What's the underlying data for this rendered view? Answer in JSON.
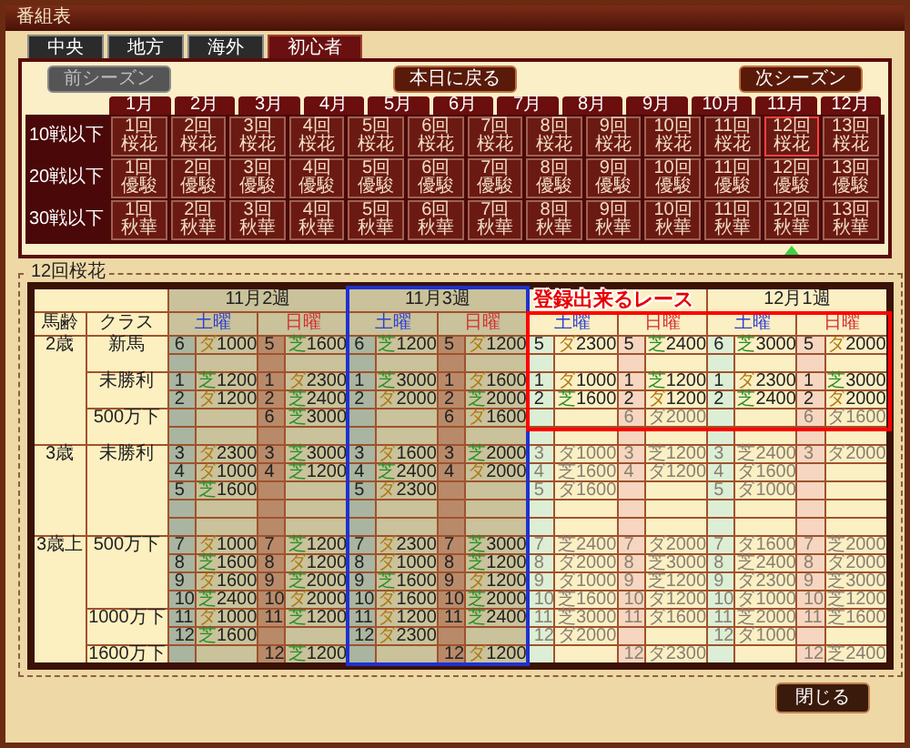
{
  "window": {
    "title": "番組表"
  },
  "tabs": [
    {
      "label": "中央",
      "selected": false
    },
    {
      "label": "地方",
      "selected": false
    },
    {
      "label": "海外",
      "selected": false
    },
    {
      "label": "初心者",
      "selected": true
    }
  ],
  "season_buttons": [
    {
      "label": "前シーズン",
      "disabled": true
    },
    {
      "label": "本日に戻る",
      "disabled": false
    },
    {
      "label": "次シーズン",
      "disabled": false
    }
  ],
  "race_calendar": {
    "months": [
      "1月",
      "2月",
      "3月",
      "4月",
      "5月",
      "6月",
      "7月",
      "8月",
      "9月",
      "10月",
      "11月",
      "12月"
    ],
    "rows": [
      {
        "label": "10戦以下",
        "cells": [
          {
            "label": "1回桜花",
            "selected": false,
            "today": false
          },
          {
            "label": "2回桜花",
            "selected": false,
            "today": false
          },
          {
            "label": "3回桜花",
            "selected": false,
            "today": false
          },
          {
            "label": "4回桜花",
            "selected": false,
            "today": false
          },
          {
            "label": "5回桜花",
            "selected": false,
            "today": false
          },
          {
            "label": "6回桜花",
            "selected": false,
            "today": false
          },
          {
            "label": "7回桜花",
            "selected": false,
            "today": false
          },
          {
            "label": "8回桜花",
            "selected": false,
            "today": false
          },
          {
            "label": "9回桜花",
            "selected": false,
            "today": false
          },
          {
            "label": "10回桜花",
            "selected": false,
            "today": false
          },
          {
            "label": "11回桜花",
            "selected": false,
            "today": false
          },
          {
            "label": "12回桜花",
            "selected": true,
            "today": false
          },
          {
            "label": "13回桜花",
            "selected": false,
            "today": false
          }
        ]
      },
      {
        "label": "20戦以下",
        "cells": [
          {
            "label": "1回優駿",
            "selected": false,
            "today": false
          },
          {
            "label": "2回優駿",
            "selected": false,
            "today": false
          },
          {
            "label": "3回優駿",
            "selected": false,
            "today": false
          },
          {
            "label": "4回優駿",
            "selected": false,
            "today": false
          },
          {
            "label": "5回優駿",
            "selected": false,
            "today": false
          },
          {
            "label": "6回優駿",
            "selected": false,
            "today": false
          },
          {
            "label": "7回優駿",
            "selected": false,
            "today": false
          },
          {
            "label": "8回優駿",
            "selected": false,
            "today": false
          },
          {
            "label": "9回優駿",
            "selected": false,
            "today": false
          },
          {
            "label": "10回優駿",
            "selected": false,
            "today": false
          },
          {
            "label": "11回優駿",
            "selected": false,
            "today": false
          },
          {
            "label": "12回優駿",
            "selected": false,
            "today": false
          },
          {
            "label": "13回優駿",
            "selected": false,
            "today": false
          }
        ]
      },
      {
        "label": "30戦以下",
        "cells": [
          {
            "label": "1回秋華",
            "selected": false,
            "today": false
          },
          {
            "label": "2回秋華",
            "selected": false,
            "today": false
          },
          {
            "label": "3回秋華",
            "selected": false,
            "today": false
          },
          {
            "label": "4回秋華",
            "selected": false,
            "today": false
          },
          {
            "label": "5回秋華",
            "selected": false,
            "today": false
          },
          {
            "label": "6回秋華",
            "selected": false,
            "today": false
          },
          {
            "label": "7回秋華",
            "selected": false,
            "today": false
          },
          {
            "label": "8回秋華",
            "selected": false,
            "today": false
          },
          {
            "label": "9回秋華",
            "selected": false,
            "today": false
          },
          {
            "label": "10回秋華",
            "selected": false,
            "today": false
          },
          {
            "label": "11回秋華",
            "selected": false,
            "today": false
          },
          {
            "label": "12回秋華",
            "selected": false,
            "today": true
          },
          {
            "label": "13回秋華",
            "selected": false,
            "today": false
          }
        ]
      }
    ]
  },
  "schedule": {
    "title": "12回桜花",
    "age_heading": "馬齢",
    "class_heading": "クラス",
    "weeks": [
      {
        "label": "11月2週",
        "past": true,
        "current": false,
        "days": [
          {
            "label": "土曜",
            "kind": "sat"
          },
          {
            "label": "日曜",
            "kind": "sun"
          }
        ]
      },
      {
        "label": "11月3週",
        "past": true,
        "current": true,
        "days": [
          {
            "label": "土曜",
            "kind": "sat"
          },
          {
            "label": "日曜",
            "kind": "sun"
          }
        ]
      },
      {
        "past": false,
        "current": false,
        "days": [
          {
            "label": "土曜",
            "kind": "sat"
          },
          {
            "label": "日曜",
            "kind": "sun"
          }
        ]
      },
      {
        "label": "12月1週",
        "past": false,
        "current": false,
        "days": [
          {
            "label": "土曜",
            "kind": "sat"
          },
          {
            "label": "日曜",
            "kind": "sun"
          }
        ]
      }
    ],
    "groups": [
      {
        "age": "2歳",
        "classes": [
          {
            "name": "新馬",
            "lines": [
              {
                "kind": "races",
                "cells": [
                  {
                    "no": "6",
                    "surface": "ダ",
                    "distance": "1000",
                    "kind": "dirt",
                    "open": true
                  },
                  {
                    "no": "5",
                    "surface": "芝",
                    "distance": "1600",
                    "kind": "turf",
                    "open": true
                  },
                  {
                    "no": "6",
                    "surface": "芝",
                    "distance": "1200",
                    "kind": "turf",
                    "open": true
                  },
                  {
                    "no": "5",
                    "surface": "ダ",
                    "distance": "1200",
                    "kind": "dirt",
                    "open": true
                  },
                  {
                    "no": "5",
                    "surface": "ダ",
                    "distance": "2300",
                    "kind": "dirt",
                    "open": true
                  },
                  {
                    "no": "5",
                    "surface": "芝",
                    "distance": "2400",
                    "kind": "turf",
                    "open": true
                  },
                  {
                    "no": "6",
                    "surface": "芝",
                    "distance": "3000",
                    "kind": "turf",
                    "open": true
                  },
                  {
                    "no": "5",
                    "surface": "ダ",
                    "distance": "2000",
                    "kind": "dirt",
                    "open": true
                  }
                ]
              },
              {
                "kind": "blank"
              }
            ]
          },
          {
            "name": "未勝利",
            "lines": [
              {
                "kind": "races",
                "cells": [
                  {
                    "no": "1",
                    "surface": "芝",
                    "distance": "1200",
                    "kind": "turf",
                    "open": true
                  },
                  {
                    "no": "1",
                    "surface": "ダ",
                    "distance": "2300",
                    "kind": "dirt",
                    "open": true
                  },
                  {
                    "no": "1",
                    "surface": "芝",
                    "distance": "3000",
                    "kind": "turf",
                    "open": true
                  },
                  {
                    "no": "1",
                    "surface": "ダ",
                    "distance": "1600",
                    "kind": "dirt",
                    "open": true
                  },
                  {
                    "no": "1",
                    "surface": "ダ",
                    "distance": "1000",
                    "kind": "dirt",
                    "open": true
                  },
                  {
                    "no": "1",
                    "surface": "芝",
                    "distance": "1200",
                    "kind": "turf",
                    "open": true
                  },
                  {
                    "no": "1",
                    "surface": "ダ",
                    "distance": "2300",
                    "kind": "dirt",
                    "open": true
                  },
                  {
                    "no": "1",
                    "surface": "芝",
                    "distance": "3000",
                    "kind": "turf",
                    "open": true
                  }
                ]
              },
              {
                "kind": "races",
                "cells": [
                  {
                    "no": "2",
                    "surface": "ダ",
                    "distance": "1200",
                    "kind": "dirt",
                    "open": true
                  },
                  {
                    "no": "2",
                    "surface": "芝",
                    "distance": "2400",
                    "kind": "turf",
                    "open": true
                  },
                  {
                    "no": "2",
                    "surface": "ダ",
                    "distance": "2000",
                    "kind": "dirt",
                    "open": true
                  },
                  {
                    "no": "2",
                    "surface": "芝",
                    "distance": "2000",
                    "kind": "turf",
                    "open": true
                  },
                  {
                    "no": "2",
                    "surface": "芝",
                    "distance": "1600",
                    "kind": "turf",
                    "open": true
                  },
                  {
                    "no": "2",
                    "surface": "ダ",
                    "distance": "1200",
                    "kind": "dirt",
                    "open": true
                  },
                  {
                    "no": "2",
                    "surface": "芝",
                    "distance": "2400",
                    "kind": "turf",
                    "open": true
                  },
                  {
                    "no": "2",
                    "surface": "ダ",
                    "distance": "2000",
                    "kind": "dirt",
                    "open": true
                  }
                ]
              }
            ]
          },
          {
            "name": "500万下",
            "lines": [
              {
                "kind": "races",
                "cells": [
                  {
                    "kind": "none"
                  },
                  {
                    "no": "6",
                    "surface": "芝",
                    "distance": "3000",
                    "kind": "turf",
                    "open": true
                  },
                  {
                    "kind": "none"
                  },
                  {
                    "no": "6",
                    "surface": "ダ",
                    "distance": "1600",
                    "kind": "dirt",
                    "open": true
                  },
                  {
                    "kind": "none"
                  },
                  {
                    "no": "6",
                    "surface": "ダ",
                    "distance": "2000",
                    "kind": "dirt",
                    "open": false
                  },
                  {
                    "kind": "none"
                  },
                  {
                    "no": "6",
                    "surface": "ダ",
                    "distance": "1600",
                    "kind": "dirt",
                    "open": false
                  }
                ]
              },
              {
                "kind": "blank"
              }
            ]
          }
        ]
      },
      {
        "age": "3歳",
        "classes": [
          {
            "name": "未勝利",
            "lines": [
              {
                "kind": "races",
                "cells": [
                  {
                    "no": "3",
                    "surface": "ダ",
                    "distance": "2300",
                    "kind": "dirt",
                    "open": true
                  },
                  {
                    "no": "3",
                    "surface": "芝",
                    "distance": "3000",
                    "kind": "turf",
                    "open": true
                  },
                  {
                    "no": "3",
                    "surface": "ダ",
                    "distance": "1600",
                    "kind": "dirt",
                    "open": true
                  },
                  {
                    "no": "3",
                    "surface": "芝",
                    "distance": "2000",
                    "kind": "turf",
                    "open": true
                  },
                  {
                    "no": "3",
                    "surface": "ダ",
                    "distance": "1000",
                    "kind": "dirt",
                    "open": false
                  },
                  {
                    "no": "3",
                    "surface": "芝",
                    "distance": "1200",
                    "kind": "turf",
                    "open": false
                  },
                  {
                    "no": "3",
                    "surface": "芝",
                    "distance": "2400",
                    "kind": "turf",
                    "open": false
                  },
                  {
                    "no": "3",
                    "surface": "ダ",
                    "distance": "2000",
                    "kind": "dirt",
                    "open": false
                  }
                ]
              },
              {
                "kind": "races",
                "cells": [
                  {
                    "no": "4",
                    "surface": "ダ",
                    "distance": "1000",
                    "kind": "dirt",
                    "open": true
                  },
                  {
                    "no": "4",
                    "surface": "芝",
                    "distance": "1200",
                    "kind": "turf",
                    "open": true
                  },
                  {
                    "no": "4",
                    "surface": "芝",
                    "distance": "2400",
                    "kind": "turf",
                    "open": true
                  },
                  {
                    "no": "4",
                    "surface": "ダ",
                    "distance": "2000",
                    "kind": "dirt",
                    "open": true
                  },
                  {
                    "no": "4",
                    "surface": "芝",
                    "distance": "1600",
                    "kind": "turf",
                    "open": false
                  },
                  {
                    "no": "4",
                    "surface": "ダ",
                    "distance": "1200",
                    "kind": "dirt",
                    "open": false
                  },
                  {
                    "no": "4",
                    "surface": "ダ",
                    "distance": "1600",
                    "kind": "dirt",
                    "open": false
                  },
                  {
                    "kind": "none"
                  }
                ]
              },
              {
                "kind": "races",
                "cells": [
                  {
                    "no": "5",
                    "surface": "芝",
                    "distance": "1600",
                    "kind": "turf",
                    "open": true
                  },
                  {
                    "kind": "none"
                  },
                  {
                    "no": "5",
                    "surface": "ダ",
                    "distance": "2300",
                    "kind": "dirt",
                    "open": true
                  },
                  {
                    "kind": "none"
                  },
                  {
                    "no": "5",
                    "surface": "ダ",
                    "distance": "1600",
                    "kind": "dirt",
                    "open": false
                  },
                  {
                    "kind": "none"
                  },
                  {
                    "no": "5",
                    "surface": "ダ",
                    "distance": "1000",
                    "kind": "dirt",
                    "open": false
                  },
                  {
                    "kind": "none"
                  }
                ]
              },
              {
                "kind": "blank"
              },
              {
                "kind": "blank"
              }
            ]
          }
        ]
      },
      {
        "age": "3歳上",
        "classes": [
          {
            "name": "500万下",
            "lines": [
              {
                "kind": "races",
                "cells": [
                  {
                    "no": "7",
                    "surface": "ダ",
                    "distance": "1000",
                    "kind": "dirt",
                    "open": true
                  },
                  {
                    "no": "7",
                    "surface": "芝",
                    "distance": "1200",
                    "kind": "turf",
                    "open": true
                  },
                  {
                    "no": "7",
                    "surface": "ダ",
                    "distance": "2300",
                    "kind": "dirt",
                    "open": true
                  },
                  {
                    "no": "7",
                    "surface": "芝",
                    "distance": "3000",
                    "kind": "turf",
                    "open": true
                  },
                  {
                    "no": "7",
                    "surface": "芝",
                    "distance": "2400",
                    "kind": "turf",
                    "open": false
                  },
                  {
                    "no": "7",
                    "surface": "ダ",
                    "distance": "2000",
                    "kind": "dirt",
                    "open": false
                  },
                  {
                    "no": "7",
                    "surface": "ダ",
                    "distance": "1600",
                    "kind": "dirt",
                    "open": false
                  },
                  {
                    "no": "7",
                    "surface": "芝",
                    "distance": "2000",
                    "kind": "turf",
                    "open": false
                  }
                ]
              },
              {
                "kind": "races",
                "cells": [
                  {
                    "no": "8",
                    "surface": "芝",
                    "distance": "1600",
                    "kind": "turf",
                    "open": true
                  },
                  {
                    "no": "8",
                    "surface": "ダ",
                    "distance": "1200",
                    "kind": "dirt",
                    "open": true
                  },
                  {
                    "no": "8",
                    "surface": "ダ",
                    "distance": "1000",
                    "kind": "dirt",
                    "open": true
                  },
                  {
                    "no": "8",
                    "surface": "芝",
                    "distance": "1200",
                    "kind": "turf",
                    "open": true
                  },
                  {
                    "no": "8",
                    "surface": "ダ",
                    "distance": "2000",
                    "kind": "dirt",
                    "open": false
                  },
                  {
                    "no": "8",
                    "surface": "芝",
                    "distance": "3000",
                    "kind": "turf",
                    "open": false
                  },
                  {
                    "no": "8",
                    "surface": "芝",
                    "distance": "2400",
                    "kind": "turf",
                    "open": false
                  },
                  {
                    "no": "8",
                    "surface": "ダ",
                    "distance": "2000",
                    "kind": "dirt",
                    "open": false
                  }
                ]
              },
              {
                "kind": "races",
                "cells": [
                  {
                    "no": "9",
                    "surface": "ダ",
                    "distance": "1600",
                    "kind": "dirt",
                    "open": true
                  },
                  {
                    "no": "9",
                    "surface": "芝",
                    "distance": "2000",
                    "kind": "turf",
                    "open": true
                  },
                  {
                    "no": "9",
                    "surface": "芝",
                    "distance": "1600",
                    "kind": "turf",
                    "open": true
                  },
                  {
                    "no": "9",
                    "surface": "ダ",
                    "distance": "1200",
                    "kind": "dirt",
                    "open": true
                  },
                  {
                    "no": "9",
                    "surface": "ダ",
                    "distance": "1000",
                    "kind": "dirt",
                    "open": false
                  },
                  {
                    "no": "9",
                    "surface": "芝",
                    "distance": "1200",
                    "kind": "turf",
                    "open": false
                  },
                  {
                    "no": "9",
                    "surface": "ダ",
                    "distance": "2300",
                    "kind": "dirt",
                    "open": false
                  },
                  {
                    "no": "9",
                    "surface": "芝",
                    "distance": "3000",
                    "kind": "turf",
                    "open": false
                  }
                ]
              },
              {
                "kind": "races",
                "cells": [
                  {
                    "no": "10",
                    "surface": "芝",
                    "distance": "2400",
                    "kind": "turf",
                    "open": true
                  },
                  {
                    "no": "10",
                    "surface": "ダ",
                    "distance": "2000",
                    "kind": "dirt",
                    "open": true
                  },
                  {
                    "no": "10",
                    "surface": "ダ",
                    "distance": "1600",
                    "kind": "dirt",
                    "open": true
                  },
                  {
                    "no": "10",
                    "surface": "芝",
                    "distance": "2000",
                    "kind": "turf",
                    "open": true
                  },
                  {
                    "no": "10",
                    "surface": "芝",
                    "distance": "1600",
                    "kind": "turf",
                    "open": false
                  },
                  {
                    "no": "10",
                    "surface": "ダ",
                    "distance": "1200",
                    "kind": "dirt",
                    "open": false
                  },
                  {
                    "no": "10",
                    "surface": "ダ",
                    "distance": "1000",
                    "kind": "dirt",
                    "open": false
                  },
                  {
                    "no": "10",
                    "surface": "芝",
                    "distance": "1200",
                    "kind": "turf",
                    "open": false
                  }
                ]
              }
            ]
          },
          {
            "name": "1000万下",
            "lines": [
              {
                "kind": "races",
                "cells": [
                  {
                    "no": "11",
                    "surface": "ダ",
                    "distance": "1000",
                    "kind": "dirt",
                    "open": true
                  },
                  {
                    "no": "11",
                    "surface": "芝",
                    "distance": "1200",
                    "kind": "turf",
                    "open": true
                  },
                  {
                    "no": "11",
                    "surface": "ダ",
                    "distance": "1200",
                    "kind": "dirt",
                    "open": true
                  },
                  {
                    "no": "11",
                    "surface": "芝",
                    "distance": "2400",
                    "kind": "turf",
                    "open": true
                  },
                  {
                    "no": "11",
                    "surface": "芝",
                    "distance": "3000",
                    "kind": "turf",
                    "open": false
                  },
                  {
                    "no": "11",
                    "surface": "ダ",
                    "distance": "1600",
                    "kind": "dirt",
                    "open": false
                  },
                  {
                    "no": "11",
                    "surface": "芝",
                    "distance": "2000",
                    "kind": "turf",
                    "open": false
                  },
                  {
                    "no": "11",
                    "surface": "芝",
                    "distance": "1600",
                    "kind": "turf",
                    "open": false
                  }
                ]
              },
              {
                "kind": "races",
                "cells": [
                  {
                    "no": "12",
                    "surface": "芝",
                    "distance": "1600",
                    "kind": "turf",
                    "open": true
                  },
                  {
                    "kind": "none"
                  },
                  {
                    "no": "12",
                    "surface": "ダ",
                    "distance": "2300",
                    "kind": "dirt",
                    "open": true
                  },
                  {
                    "kind": "none"
                  },
                  {
                    "no": "12",
                    "surface": "ダ",
                    "distance": "2000",
                    "kind": "dirt",
                    "open": false
                  },
                  {
                    "kind": "none"
                  },
                  {
                    "no": "12",
                    "surface": "ダ",
                    "distance": "1000",
                    "kind": "dirt",
                    "open": false
                  },
                  {
                    "kind": "none"
                  }
                ]
              }
            ]
          },
          {
            "name": "1600万下",
            "lines": [
              {
                "kind": "races",
                "cells": [
                  {
                    "kind": "none"
                  },
                  {
                    "no": "12",
                    "surface": "芝",
                    "distance": "1200",
                    "kind": "turf",
                    "open": true
                  },
                  {
                    "kind": "none"
                  },
                  {
                    "no": "12",
                    "surface": "ダ",
                    "distance": "1200",
                    "kind": "dirt",
                    "open": true
                  },
                  {
                    "kind": "none"
                  },
                  {
                    "no": "12",
                    "surface": "ダ",
                    "distance": "2300",
                    "kind": "dirt",
                    "open": false
                  },
                  {
                    "kind": "none"
                  },
                  {
                    "no": "12",
                    "surface": "芝",
                    "distance": "2400",
                    "kind": "turf",
                    "open": false
                  }
                ]
              }
            ]
          }
        ]
      }
    ],
    "annotation": {
      "text": "登録出来るレース"
    }
  },
  "close_button": {
    "label": "閉じる"
  }
}
